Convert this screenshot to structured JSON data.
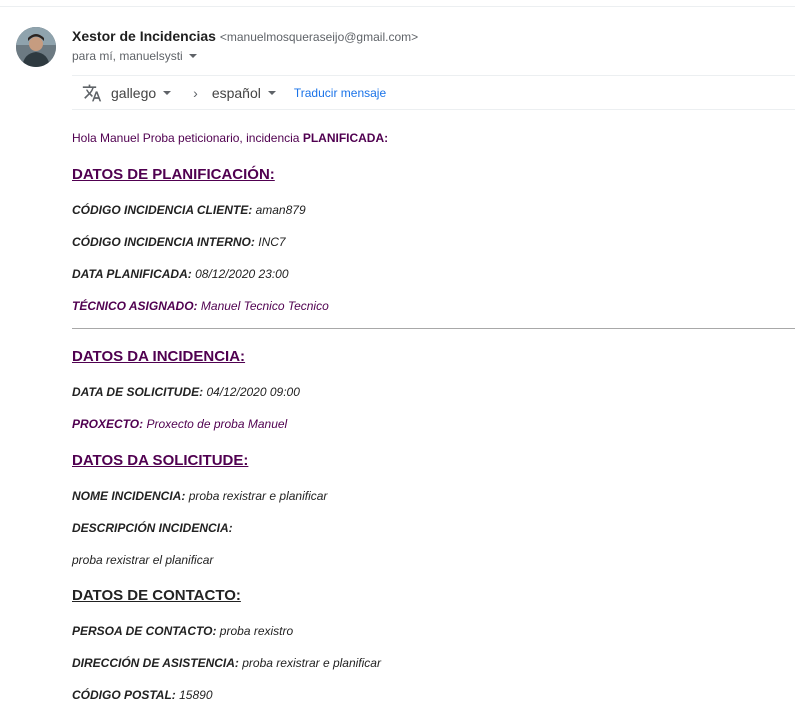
{
  "email": {
    "sender_name": "Xestor de Incidencias",
    "sender_email": "<manuelmosqueraseijo@gmail.com>",
    "recipients": "para mí, manuelsysti"
  },
  "translate": {
    "source_lang": "gallego",
    "target_lang": "español",
    "translate_link": "Traducir mensaje"
  },
  "message": {
    "greeting": "Hola Manuel Proba peticionario, incidencia",
    "greeting_status": "PLANIFICADA:",
    "section1": "DATOS DE PLANIFICACIÓN:",
    "codigo_cliente_label": "CÓDIGO INCIDENCIA CLIENTE:",
    "codigo_cliente_value": "aman879",
    "codigo_interno_label": "CÓDIGO INCIDENCIA INTERNO:",
    "codigo_interno_value": "INC7",
    "data_planificada_label": "DATA PLANIFICADA:",
    "data_planificada_value": "08/12/2020 23:00",
    "tecnico_label": "TÉCNICO ASIGNADO:",
    "tecnico_value": "Manuel Tecnico Tecnico",
    "section2": "DATOS DA INCIDENCIA:",
    "data_solicitude_label": "DATA DE SOLICITUDE:",
    "data_solicitude_value": "04/12/2020 09:00",
    "proxecto_label": "PROXECTO:",
    "proxecto_value": "Proxecto de proba Manuel",
    "section3": "DATOS DA SOLICITUDE:",
    "nome_label": "NOME INCIDENCIA:",
    "nome_value": "proba rexistrar e planificar",
    "descripcion_label": "DESCRIPCIÓN INCIDENCIA:",
    "descripcion_value": "proba rexistrar el planificar",
    "section4": "DATOS DE CONTACTO:",
    "persoa_label": "PERSOA DE CONTACTO:",
    "persoa_value": "proba rexistro",
    "direccion_label": "DIRECCIÓN DE ASISTENCIA:",
    "direccion_value": "proba rexistrar e planificar",
    "cp_label": "CÓDIGO POSTAL:",
    "cp_value": "15890"
  },
  "icons": {
    "avatar": "avatar",
    "translate": "translate-icon",
    "dropdown": "caret-down-icon",
    "chevron": "chevron-right-icon"
  },
  "colors": {
    "purple_text": "#500050",
    "link_blue": "#1a73e8",
    "secondary_text": "#5f6368"
  }
}
